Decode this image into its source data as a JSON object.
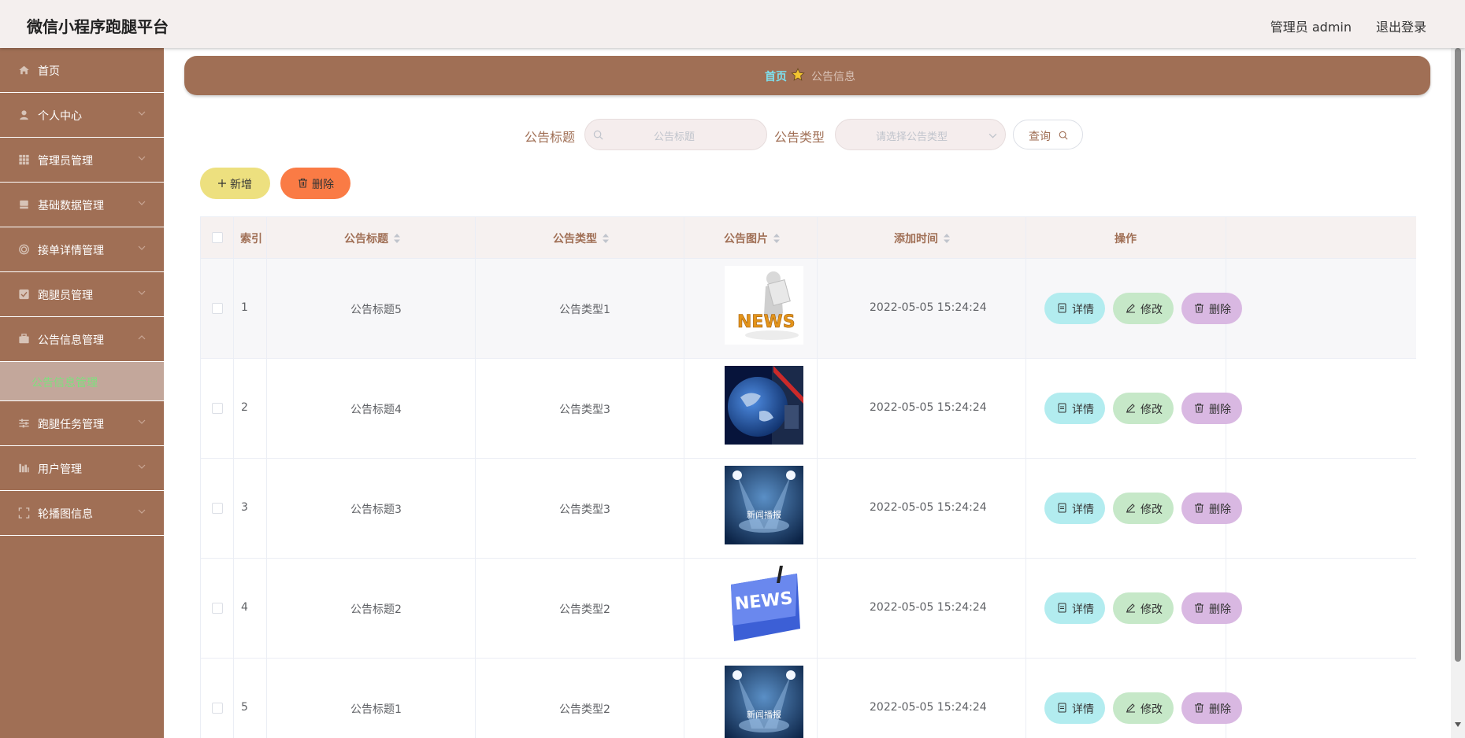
{
  "app": {
    "title": "微信小程序跑腿平台",
    "user": "管理员 admin",
    "logout": "退出登录"
  },
  "colors": {
    "primary": "#a06f55",
    "header_bg": "#f4efee",
    "active_text": "#7ee07e",
    "breadcrumb_home": "#7ee0ee"
  },
  "sidebar": {
    "items": [
      {
        "label": "首页",
        "icon": "home-icon"
      },
      {
        "label": "个人中心",
        "icon": "user-icon"
      },
      {
        "label": "管理员管理",
        "icon": "grid-icon"
      },
      {
        "label": "基础数据管理",
        "icon": "database-icon"
      },
      {
        "label": "接单详情管理",
        "icon": "target-icon"
      },
      {
        "label": "跑腿员管理",
        "icon": "checkbox-icon"
      },
      {
        "label": "公告信息管理",
        "icon": "briefcase-icon"
      },
      {
        "label": "跑腿任务管理",
        "icon": "sliders-icon"
      },
      {
        "label": "用户管理",
        "icon": "chart-icon"
      },
      {
        "label": "轮播图信息",
        "icon": "frame-icon"
      }
    ],
    "active_submenu": "公告信息管理"
  },
  "breadcrumb": {
    "home": "首页",
    "current": "公告信息"
  },
  "search": {
    "title_label": "公告标题",
    "title_placeholder": "公告标题",
    "type_label": "公告类型",
    "type_placeholder": "请选择公告类型",
    "button": "查询"
  },
  "actions": {
    "add": "新增",
    "delete": "删除"
  },
  "table": {
    "headers": {
      "index": "索引",
      "title": "公告标题",
      "type": "公告类型",
      "image": "公告图片",
      "time": "添加时间",
      "ops": "操作"
    },
    "op_labels": {
      "detail": "详情",
      "edit": "修改",
      "delete": "删除"
    },
    "rows": [
      {
        "index": "1",
        "title": "公告标题5",
        "type": "公告类型1",
        "image": "news-figure",
        "time": "2022-05-05 15:24:24"
      },
      {
        "index": "2",
        "title": "公告标题4",
        "type": "公告类型3",
        "image": "globe-broadcast",
        "time": "2022-05-05 15:24:24"
      },
      {
        "index": "3",
        "title": "公告标题3",
        "type": "公告类型3",
        "image": "spotlight-news",
        "image_caption": "新闻播报",
        "time": "2022-05-05 15:24:24"
      },
      {
        "index": "4",
        "title": "公告标题2",
        "type": "公告类型2",
        "image": "news-key",
        "image_caption": "NEWS",
        "time": "2022-05-05 15:24:24"
      },
      {
        "index": "5",
        "title": "公告标题1",
        "type": "公告类型2",
        "image": "spotlight-news",
        "image_caption": "新闻播报",
        "time": "2022-05-05 15:24:24"
      }
    ]
  }
}
